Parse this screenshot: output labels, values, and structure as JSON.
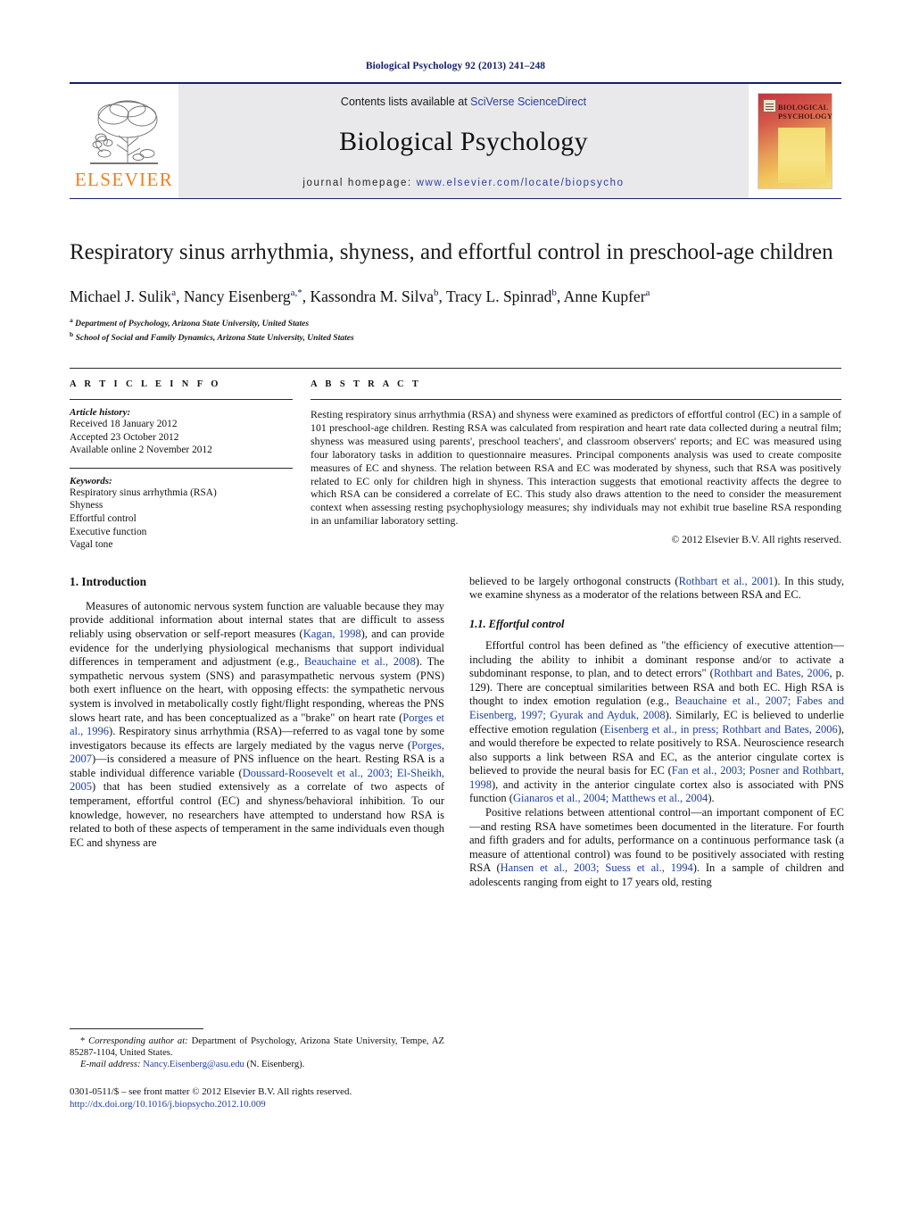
{
  "running_head": "Biological Psychology 92 (2013) 241–248",
  "masthead": {
    "publisher_name": "ELSEVIER",
    "contents_prefix": "Contents lists available at ",
    "contents_link": "SciVerse ScienceDirect",
    "journal_name": "Biological Psychology",
    "homepage_prefix": "journal homepage: ",
    "homepage_url": "www.elsevier.com/locate/biopsycho",
    "cover_title_line1": "BIOLOGICAL",
    "cover_title_line2": "PSYCHOLOGY",
    "accent_orange": "#f07f1a",
    "accent_blue": "#2b3f9e",
    "rule_blue": "#16216b"
  },
  "article": {
    "title": "Respiratory sinus arrhythmia, shyness, and effortful control in preschool-age children",
    "authors_html": "Michael J. Sulik<sup>a</sup>, Nancy Eisenberg<sup>a,*</sup>, Kassondra M. Silva<sup>b</sup>, Tracy L. Spinrad<sup>b</sup>, Anne Kupfer<sup>a</sup>",
    "affiliation_a": "Department of Psychology, Arizona State University, United States",
    "affiliation_b": "School of Social and Family Dynamics, Arizona State University, United States"
  },
  "article_info": {
    "heading": "A R T I C L E   I N F O",
    "history_label": "Article history:",
    "history": [
      "Received 18 January 2012",
      "Accepted 23 October 2012",
      "Available online 2 November 2012"
    ],
    "keywords_label": "Keywords:",
    "keywords": [
      "Respiratory sinus arrhythmia (RSA)",
      "Shyness",
      "Effortful control",
      "Executive function",
      "Vagal tone"
    ]
  },
  "abstract": {
    "heading": "A B S T R A C T",
    "text": "Resting respiratory sinus arrhythmia (RSA) and shyness were examined as predictors of effortful control (EC) in a sample of 101 preschool-age children. Resting RSA was calculated from respiration and heart rate data collected during a neutral film; shyness was measured using parents', preschool teachers', and classroom observers' reports; and EC was measured using four laboratory tasks in addition to questionnaire measures. Principal components analysis was used to create composite measures of EC and shyness. The relation between RSA and EC was moderated by shyness, such that RSA was positively related to EC only for children high in shyness. This interaction suggests that emotional reactivity affects the degree to which RSA can be considered a correlate of EC. This study also draws attention to the need to consider the measurement context when assessing resting psychophysiology measures; shy individuals may not exhibit true baseline RSA responding in an unfamiliar laboratory setting.",
    "copyright": "© 2012 Elsevier B.V. All rights reserved."
  },
  "body": {
    "section1_heading": "1.  Introduction",
    "left_para1_a": "Measures of autonomic nervous system function are valuable because they may provide additional information about internal states that are difficult to assess reliably using observation or self-report measures (",
    "left_para1_ref1": "Kagan, 1998",
    "left_para1_b": "), and can provide evidence for the underlying physiological mechanisms that support individual differences in temperament and adjustment (e.g., ",
    "left_para1_ref2": "Beauchaine et al., 2008",
    "left_para1_c": "). The sympathetic nervous system (SNS) and parasympathetic nervous system (PNS) both exert influence on the heart, with opposing effects: the sympathetic nervous system is involved in metabolically costly fight/flight responding, whereas the PNS slows heart rate, and has been conceptualized as a \"brake\" on heart rate (",
    "left_para1_ref3": "Porges et al., 1996",
    "left_para1_d": "). Respiratory sinus arrhythmia (RSA)—referred to as vagal tone by some investigators because its effects are largely mediated by the vagus nerve (",
    "left_para1_ref4": "Porges, 2007",
    "left_para1_e": ")—is considered a measure of PNS influence on the heart. Resting RSA is a stable individual difference variable (",
    "left_para1_ref5": "Doussard-Roosevelt et al., 2003; El-Sheikh, 2005",
    "left_para1_f": ") that has been studied extensively as a correlate of two aspects of temperament, effortful control (EC) and shyness/behavioral inhibition. To our knowledge, however, no researchers have attempted to understand how RSA is related to both of these aspects of temperament in the same individuals even though EC and shyness are",
    "right_para0_a": "believed to be largely orthogonal constructs (",
    "right_para0_ref1": "Rothbart et al., 2001",
    "right_para0_b": "). In this study, we examine shyness as a moderator of the relations between RSA and EC.",
    "section11_heading": "1.1.  Effortful control",
    "right_para1_a": "Effortful control has been defined as \"the efficiency of executive attention—including the ability to inhibit a dominant response and/or to activate a subdominant response, to plan, and to detect errors\" (",
    "right_para1_ref1": "Rothbart and Bates, 2006",
    "right_para1_b": ", p. 129). There are conceptual similarities between RSA and both EC. High RSA is thought to index emotion regulation (e.g., ",
    "right_para1_ref2": "Beauchaine et al., 2007; Fabes and Eisenberg, 1997; Gyurak and Ayduk, 2008",
    "right_para1_c": "). Similarly, EC is believed to underlie effective emotion regulation (",
    "right_para1_ref3": "Eisenberg et al., in press; Rothbart and Bates, 2006",
    "right_para1_d": "), and would therefore be expected to relate positively to RSA. Neuroscience research also supports a link between RSA and EC, as the anterior cingulate cortex is believed to provide the neural basis for EC (",
    "right_para1_ref4": "Fan et al., 2003; Posner and Rothbart, 1998",
    "right_para1_e": "), and activity in the anterior cingulate cortex also is associated with PNS function (",
    "right_para1_ref5": "Gianaros et al., 2004; Matthews et al., 2004",
    "right_para1_f": ").",
    "right_para2_a": "Positive relations between attentional control—an important component of EC—and resting RSA have sometimes been documented in the literature. For fourth and fifth graders and for adults, performance on a continuous performance task (a measure of attentional control) was found to be positively associated with resting RSA (",
    "right_para2_ref1": "Hansen et al., 2003; Suess et al., 1994",
    "right_para2_b": "). In a sample of children and adolescents ranging from eight to 17 years old, resting"
  },
  "footnotes": {
    "corresponding_marker": "*",
    "corresponding_label": " Corresponding author at: ",
    "corresponding_text": "Department of Psychology, Arizona State University, Tempe, AZ 85287-1104, United States.",
    "email_label": "E-mail address:",
    "email_address": "Nancy.Eisenberg@asu.edu",
    "email_owner": " (N. Eisenberg).",
    "issn_line": "0301-0511/$ – see front matter © 2012 Elsevier B.V. All rights reserved.",
    "doi_line": "http://dx.doi.org/10.1016/j.biopsycho.2012.10.009"
  }
}
